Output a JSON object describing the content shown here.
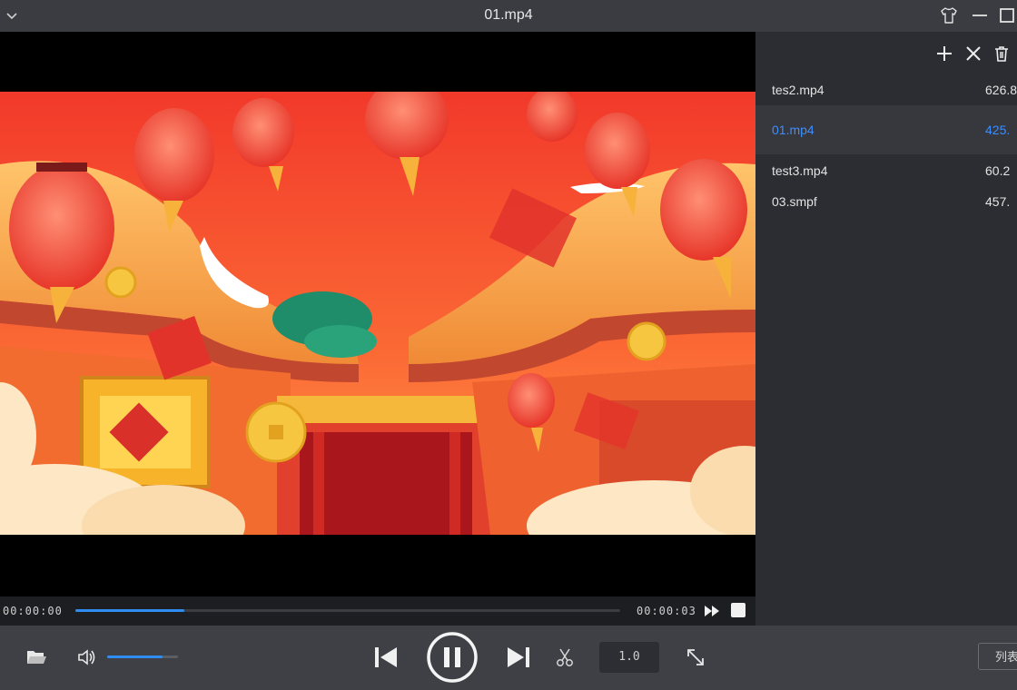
{
  "window": {
    "title": "01.mp4"
  },
  "icons": {
    "collapse": "chevron-down-icon",
    "skin": "tshirt-icon",
    "minimize": "minimize-icon",
    "maximize": "maximize-icon",
    "add": "plus-icon",
    "remove": "close-icon",
    "clear": "trash-icon",
    "open": "folder-open-icon",
    "volume": "speaker-icon",
    "prev": "skip-previous-icon",
    "pause": "pause-icon",
    "next": "skip-next-icon",
    "clip": "scissors-icon",
    "fullscreen": "expand-icon",
    "fast_forward": "fast-forward-icon",
    "stop": "stop-icon"
  },
  "playlist": {
    "items": [
      {
        "name": "tes2.mp4",
        "size": "626.8"
      },
      {
        "name": "01.mp4",
        "size": "425.",
        "active": true
      },
      {
        "name": "test3.mp4",
        "size": "60.2"
      },
      {
        "name": "03.smpf",
        "size": "457."
      }
    ]
  },
  "playback": {
    "current_time": "00:00:00",
    "total_time": "00:00:03",
    "progress": 0.2,
    "volume": 0.78,
    "speed": "1.0"
  },
  "controls": {
    "list_label": "列表"
  },
  "colors": {
    "accent": "#2f8cf0",
    "active_item": "#3d8eff",
    "background": "#26282e"
  }
}
